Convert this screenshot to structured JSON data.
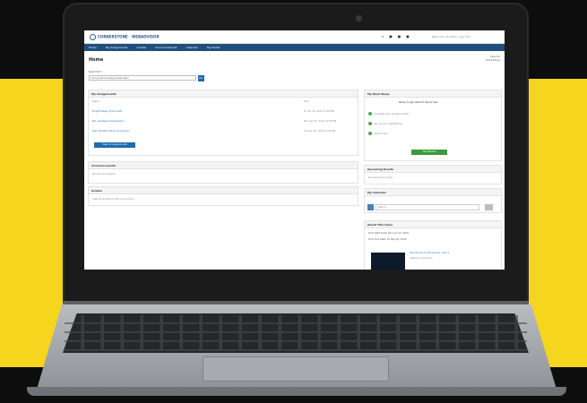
{
  "site": {
    "logo_text": "CORNERSTONE · WEBADVISOR",
    "user_link": "Welcome, Student | Sign Out"
  },
  "top_icons": [
    "search-icon",
    "user-icon",
    "bell-icon",
    "help-icon"
  ],
  "nav": [
    "Home",
    "My Assignments",
    "Grades",
    "Announcements",
    "Calendar",
    "My Media"
  ],
  "page": {
    "title": "Home",
    "right_links": [
      "Calendar",
      "Edit Settings"
    ],
    "term_label": "Select Term",
    "term_value": "Spring 2019 Undergraduate Term",
    "term_go": "Go"
  },
  "assignments": {
    "header": "My Assignments",
    "columns": [
      "Name",
      "Due"
    ],
    "rows": [
      {
        "name": "English Essay (final draft)",
        "due": "Fri Apr 12, 2019 11:59 PM"
      },
      {
        "name": "Bio: Lab Report Submission",
        "due": "Mon Apr 15, 2019 11:59 PM"
      },
      {
        "name": "Stat: Problem Set 9 (homework)",
        "due": "Tue Apr 16, 2019 11:59 PM"
      }
    ],
    "button": "View All Assignments"
  },
  "announcements": {
    "header": "Announcements",
    "empty": "No announcements."
  },
  "grades": {
    "header": "Grades",
    "text": "View all grades for the current term."
  },
  "next_steps": {
    "header": "My Next Steps",
    "intro": "Ready to get started? Here's how:",
    "items": [
      "Complete your student profile",
      "Set up your notifications",
      "Get the app"
    ],
    "button": "Get Started"
  },
  "upcoming_events": {
    "header": "Upcoming Events",
    "text": "No upcoming events."
  },
  "calendar": {
    "header": "My Calendar",
    "placeholder": "Search..."
  },
  "about": {
    "header": "About This Class",
    "lines": [
      "Term Start Date: Mon Jan 14, 2019",
      "Term End Date: Fri May 10, 2019"
    ],
    "video_title": "Introduction to the Course - Part 1",
    "video_meta": "Added by Instructor"
  },
  "colors": {
    "band": "#f5d51e",
    "nav": "#1f4f7d",
    "primary": "#1f6bb0",
    "success": "#3b9a3b"
  }
}
